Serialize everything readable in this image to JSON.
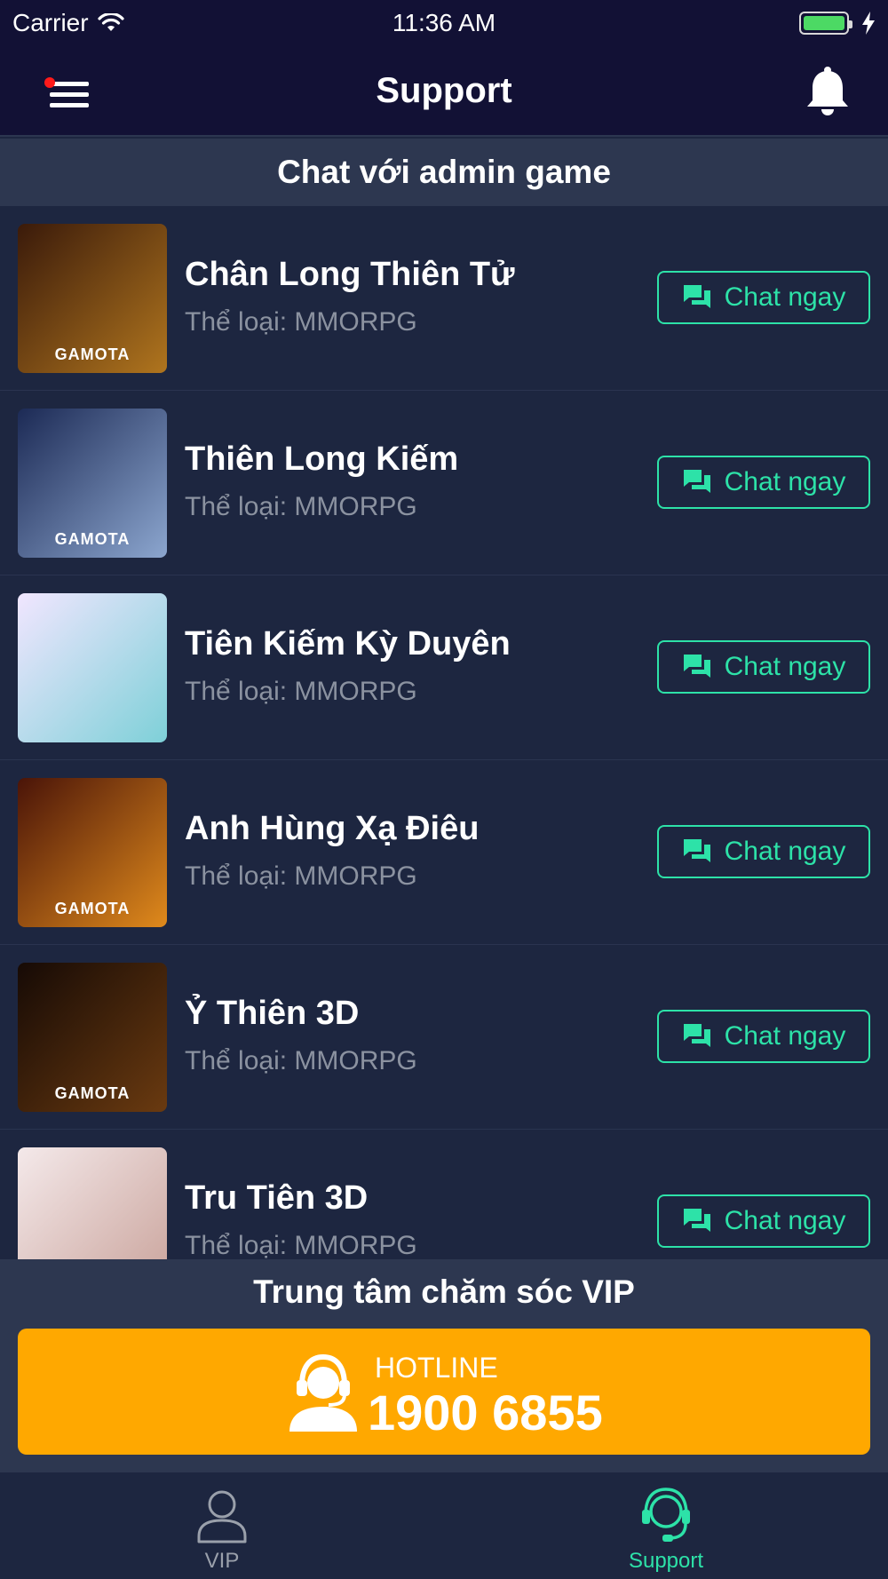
{
  "status_bar": {
    "carrier": "Carrier",
    "time": "11:36 AM"
  },
  "nav": {
    "title": "Support"
  },
  "section": {
    "title": "Chat với admin game"
  },
  "games": [
    {
      "name": "Chân Long Thiên Tử",
      "genre": "Thể loại: MMORPG",
      "chat_label": "Chat ngay",
      "thumb_brand": "GAMOTA",
      "thumb_colors": [
        "#3a1a0a",
        "#b0751e"
      ]
    },
    {
      "name": "Thiên Long Kiếm",
      "genre": "Thể loại: MMORPG",
      "chat_label": "Chat ngay",
      "thumb_brand": "GAMOTA",
      "thumb_colors": [
        "#1c2a55",
        "#8ca6cf"
      ]
    },
    {
      "name": "Tiên Kiếm Kỳ Duyên",
      "genre": "Thể loại: MMORPG",
      "chat_label": "Chat ngay",
      "thumb_brand": "",
      "thumb_colors": [
        "#f1e6ff",
        "#7ed0d8"
      ]
    },
    {
      "name": "Anh Hùng Xạ Điêu",
      "genre": "Thể loại: MMORPG",
      "chat_label": "Chat ngay",
      "thumb_brand": "GAMOTA",
      "thumb_colors": [
        "#4a1408",
        "#e08a1c"
      ]
    },
    {
      "name": "Ỷ Thiên 3D",
      "genre": "Thể loại: MMORPG",
      "chat_label": "Chat ngay",
      "thumb_brand": "GAMOTA",
      "thumb_colors": [
        "#160a05",
        "#6a3a10"
      ]
    },
    {
      "name": "Tru Tiên 3D",
      "genre": "Thể loại: MMORPG",
      "chat_label": "Chat ngay",
      "thumb_brand": "",
      "thumb_colors": [
        "#f4e9ea",
        "#c9a29a"
      ]
    }
  ],
  "vip": {
    "title": "Trung tâm chăm sóc VIP",
    "hotline_label": "HOTLINE",
    "hotline_number": "1900 6855"
  },
  "tabs": [
    {
      "label": "VIP",
      "icon": "person-icon",
      "active": false
    },
    {
      "label": "Support",
      "icon": "headset-icon",
      "active": true
    }
  ],
  "colors": {
    "accent": "#2de2a8",
    "hotline": "#ffa800",
    "nav_bg": "#121135",
    "list_bg": "#1d2640",
    "header_bg": "#2d3750",
    "notification_dot": "#ff1a1a"
  }
}
